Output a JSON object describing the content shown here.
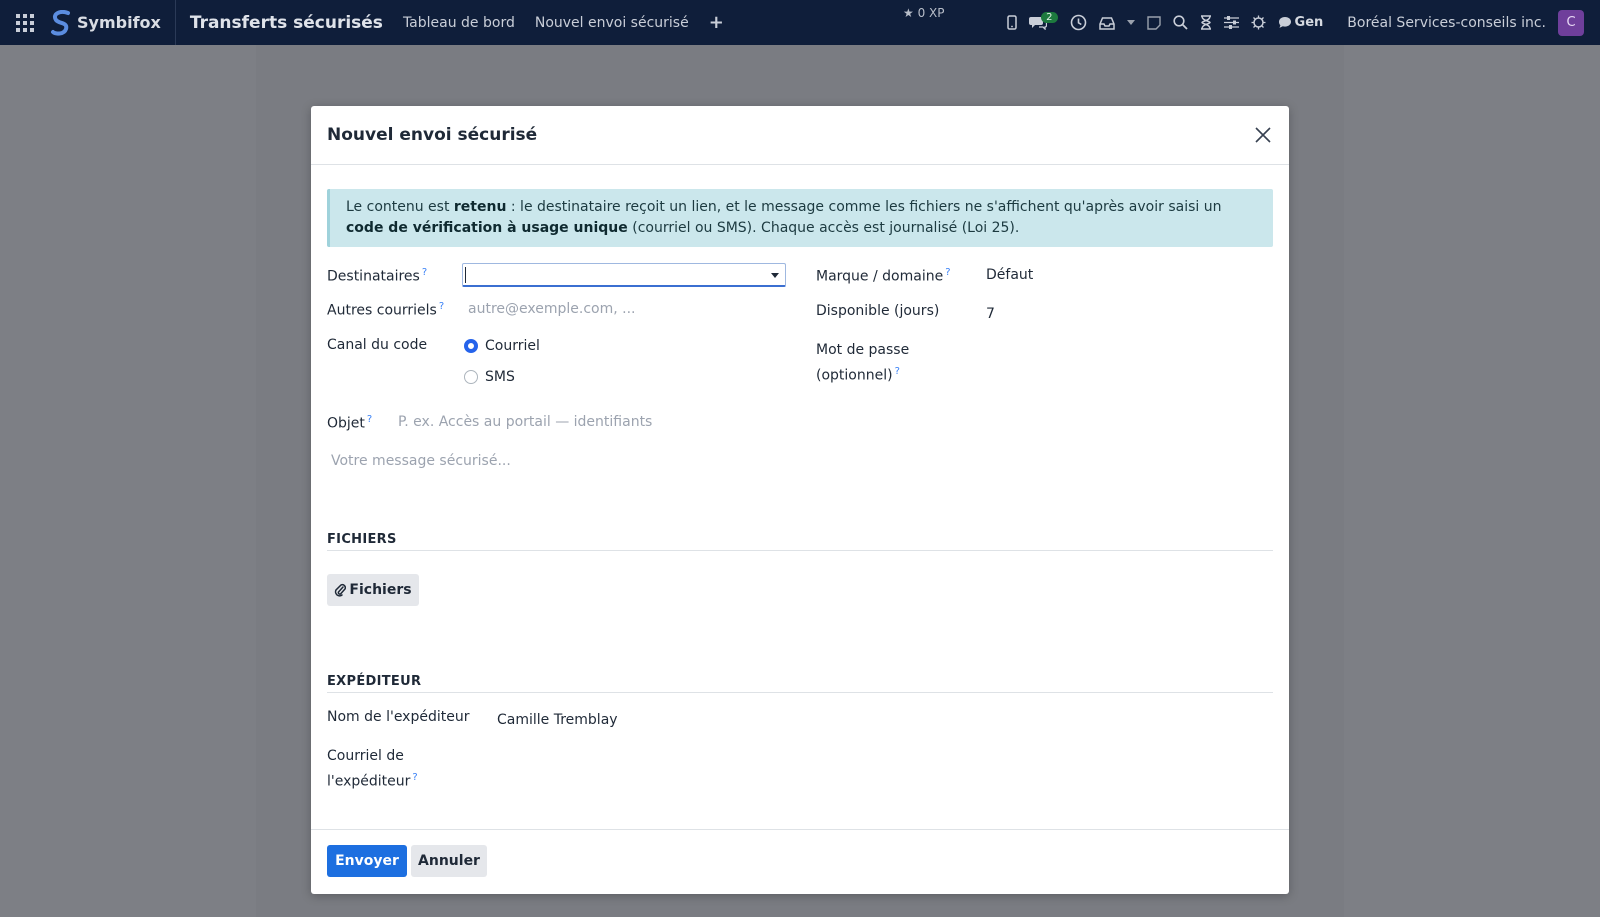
{
  "navbar": {
    "brand": "Symbifox",
    "app_title": "Transferts sécurisés",
    "links": [
      "Tableau de bord",
      "Nouvel envoi sécurisé"
    ],
    "xp": "0 XP",
    "messages_badge": "2",
    "gen_label": "Gen",
    "company": "Boréal Services-conseils inc.",
    "avatar_letter": "C"
  },
  "modal": {
    "title": "Nouvel envoi sécurisé",
    "alert": {
      "p1": "Le contenu est ",
      "b1": "retenu",
      "p2": " : le destinataire reçoit un lien, et le message comme les fichiers ne s'affichent qu'après avoir saisi un ",
      "b2": "code de vérification à usage unique",
      "p3": " (courriel ou SMS). Chaque accès est journalisé (Loi 25)."
    },
    "fields": {
      "recipients_label": "Destinataires",
      "other_emails_label": "Autres courriels",
      "other_emails_placeholder": "autre@exemple.com, ...",
      "code_channel_label": "Canal du code",
      "channel_options": [
        "Courriel",
        "SMS"
      ],
      "brand_label": "Marque / domaine",
      "brand_value": "Défaut",
      "available_label": "Disponible (jours)",
      "available_value": "7",
      "password_label_1": "Mot de passe",
      "password_label_2": "(optionnel)",
      "subject_label": "Objet",
      "subject_placeholder": "P. ex. Accès au portail — identifiants",
      "message_placeholder": "Votre message sécurisé..."
    },
    "files_section": {
      "title": "FICHIERS",
      "button": "Fichiers"
    },
    "sender_section": {
      "title": "EXPÉDITEUR",
      "name_label": "Nom de l'expéditeur",
      "name_value": "Camille Tremblay",
      "email_label_1": "Courriel de",
      "email_label_2": "l'expéditeur"
    },
    "footer": {
      "send": "Envoyer",
      "cancel": "Annuler"
    }
  }
}
